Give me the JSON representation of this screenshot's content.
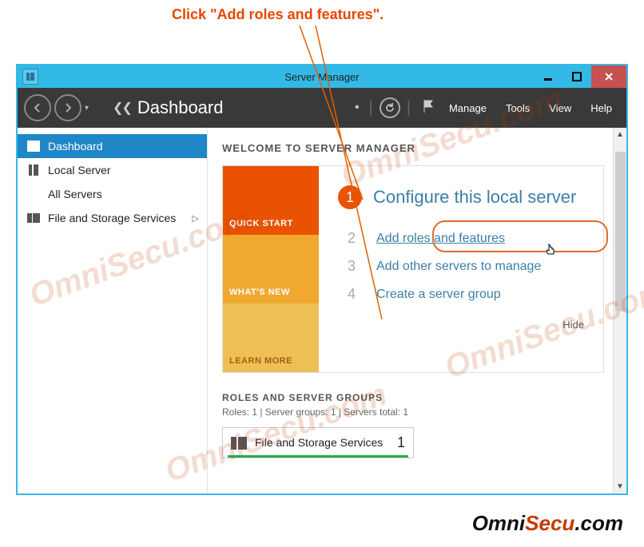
{
  "annotation_text": "Click \"Add roles and features\".",
  "window": {
    "title": "Server Manager"
  },
  "toolbar": {
    "page_title": "Dashboard",
    "menu": {
      "manage": "Manage",
      "tools": "Tools",
      "view": "View",
      "help": "Help"
    }
  },
  "sidebar": {
    "items": [
      {
        "label": "Dashboard",
        "icon": "dashboard-icon",
        "active": true
      },
      {
        "label": "Local Server",
        "icon": "local-server-icon",
        "active": false
      },
      {
        "label": "All Servers",
        "icon": "all-servers-icon",
        "active": false
      },
      {
        "label": "File and Storage Services",
        "icon": "file-storage-icon",
        "active": false,
        "has_children": true
      }
    ]
  },
  "main": {
    "welcome_heading": "WELCOME TO SERVER MANAGER",
    "left_tabs": {
      "quick_start": "QUICK START",
      "whats_new": "WHAT'S NEW",
      "learn_more": "LEARN MORE"
    },
    "step1_text": "Configure this local server",
    "steps": [
      {
        "num": "2",
        "text": "Add roles and features"
      },
      {
        "num": "3",
        "text": "Add other servers to manage"
      },
      {
        "num": "4",
        "text": "Create a server group"
      }
    ],
    "hide_label": "Hide",
    "roles_heading": "ROLES AND SERVER GROUPS",
    "roles_sub": "Roles: 1   |   Server groups: 1   |   Servers total: 1",
    "role_card": {
      "title": "File and Storage Services",
      "count": "1"
    }
  },
  "footer_brand": {
    "part1": "Omni",
    "part2": "Secu",
    "part3": ".com"
  },
  "watermark_text": "OmniSecu.com"
}
